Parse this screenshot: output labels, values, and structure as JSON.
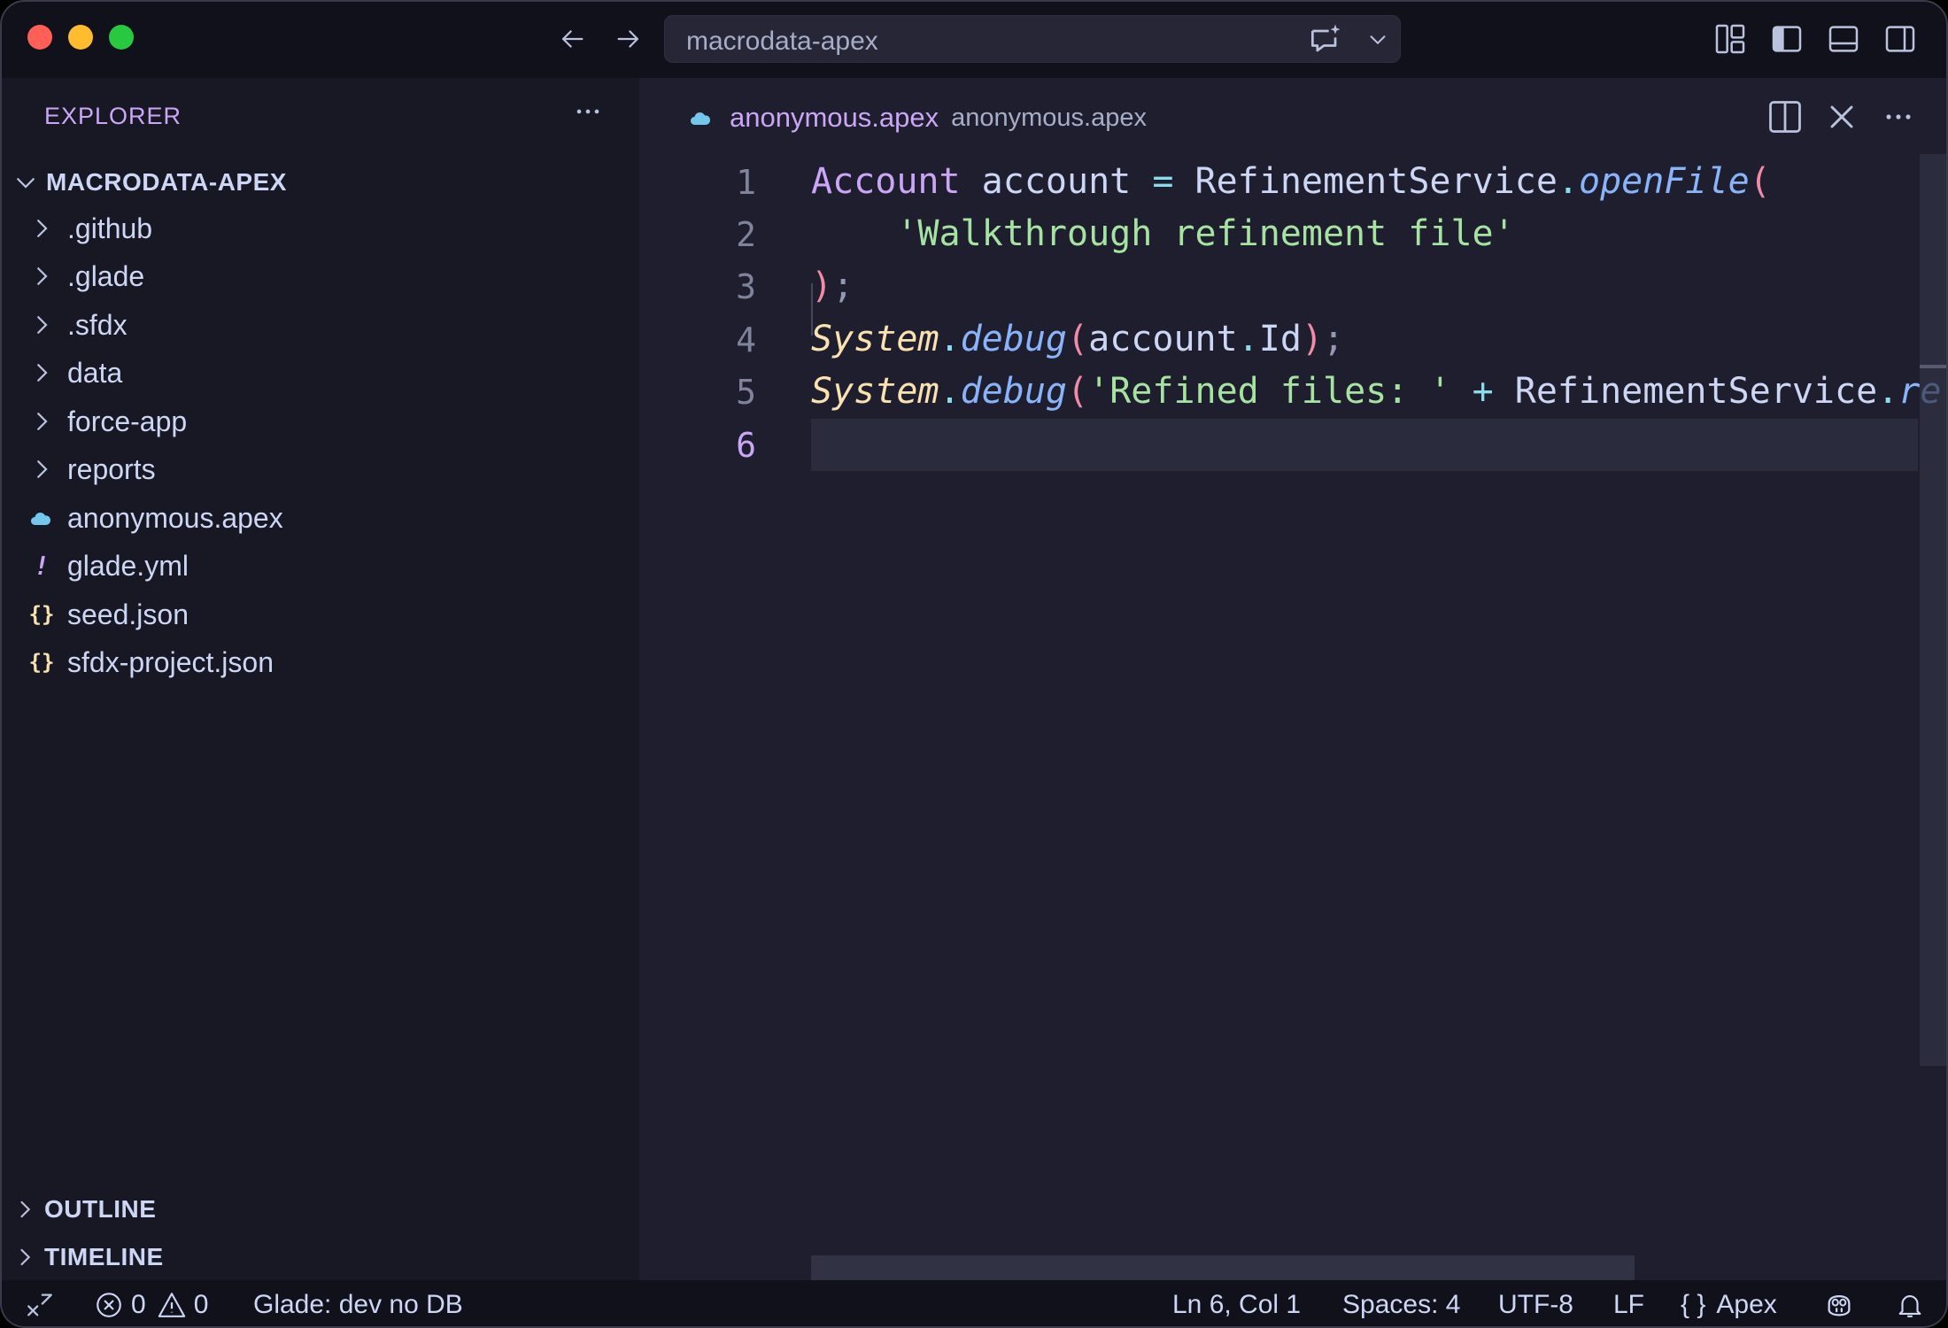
{
  "titlebar": {
    "search_text": "macrodata-apex"
  },
  "sidebar": {
    "title": "EXPLORER",
    "project": "MACRODATA-APEX",
    "items": [
      {
        "label": ".github",
        "type": "folder"
      },
      {
        "label": ".glade",
        "type": "folder"
      },
      {
        "label": ".sfdx",
        "type": "folder"
      },
      {
        "label": "data",
        "type": "folder"
      },
      {
        "label": "force-app",
        "type": "folder"
      },
      {
        "label": "reports",
        "type": "folder"
      },
      {
        "label": "anonymous.apex",
        "type": "apex",
        "icon": "salesforce-cloud-icon"
      },
      {
        "label": "glade.yml",
        "type": "yaml",
        "icon": "exclamation-icon",
        "glyph": "!"
      },
      {
        "label": "seed.json",
        "type": "json",
        "icon": "braces-icon",
        "glyph": "{}"
      },
      {
        "label": "sfdx-project.json",
        "type": "json",
        "icon": "braces-icon",
        "glyph": "{}"
      }
    ],
    "outline": "OUTLINE",
    "timeline": "TIMELINE"
  },
  "editor": {
    "tab_name": "anonymous.apex",
    "tab_description": "anonymous.apex",
    "line_numbers": [
      "1",
      "2",
      "3",
      "4",
      "5",
      "6"
    ],
    "active_line": 6,
    "code": {
      "l1": {
        "t1": "Account",
        "t2": " account ",
        "t3": "=",
        "t4": " RefinementService",
        "t5": ".",
        "t6": "openFile",
        "t7": "("
      },
      "l2": {
        "t1": "    'Walkthrough refinement file'"
      },
      "l3": {
        "t1": ")",
        "t2": ";"
      },
      "l4": {
        "t1": "System",
        "t2": ".",
        "t3": "debug",
        "t4": "(",
        "t5": "account",
        "t6": ".",
        "t7": "Id",
        "t8": ")",
        "t9": ";"
      },
      "l5": {
        "t1": "System",
        "t2": ".",
        "t3": "debug",
        "t4": "(",
        "t5": "'Refined files: '",
        "t6": " + ",
        "t7": "RefinementService",
        "t8": ".",
        "t9": "re"
      }
    }
  },
  "statusbar": {
    "errors": "0",
    "warnings": "0",
    "glade_status": "Glade: dev no DB",
    "position": "Ln 6, Col 1",
    "spaces": "Spaces: 4",
    "encoding": "UTF-8",
    "eol": "LF",
    "language_glyph": "{ }",
    "language": "Apex"
  },
  "colors": {
    "accent": "#cba6f7",
    "string": "#a6e3a1",
    "class": "#f9e2af",
    "function": "#89b4fa",
    "paren": "#f38ba8",
    "json_icon": "#f9e2af",
    "yaml_icon": "#cba6f7",
    "apex_icon": "#74c7ec"
  }
}
